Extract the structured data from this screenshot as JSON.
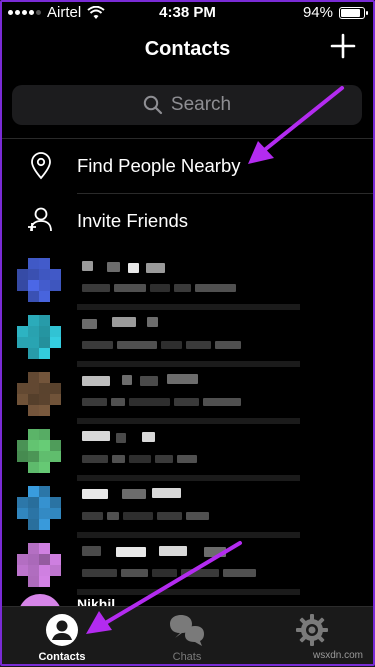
{
  "status_bar": {
    "carrier": "Airtel",
    "time": "4:38 PM",
    "battery": "94%",
    "battery_level": 0.94
  },
  "nav": {
    "title": "Contacts"
  },
  "search": {
    "placeholder": "Search"
  },
  "menu": [
    {
      "label": "Find People Nearby",
      "icon": "location-pin-icon"
    },
    {
      "label": "Invite Friends",
      "icon": "add-person-icon"
    }
  ],
  "contacts": {
    "partial_name": "Nikhil",
    "avatar_colors": [
      "#4e6cf0",
      "#35d4e6",
      "#7a5a3e",
      "#6bd37a",
      "#3ea9f0",
      "#d684e8"
    ]
  },
  "tabbar": {
    "tabs": [
      {
        "label": "Contacts",
        "icon": "person-circle-icon",
        "active": true
      },
      {
        "label": "Chats",
        "icon": "chat-bubbles-icon",
        "active": false
      },
      {
        "label": "Settings",
        "icon": "gear-icon",
        "active": false
      }
    ]
  },
  "watermark": "wsxdn.com",
  "colors": {
    "accent": "#b32bf0",
    "background": "#000000",
    "tab_bar": "#1a1a1a"
  }
}
